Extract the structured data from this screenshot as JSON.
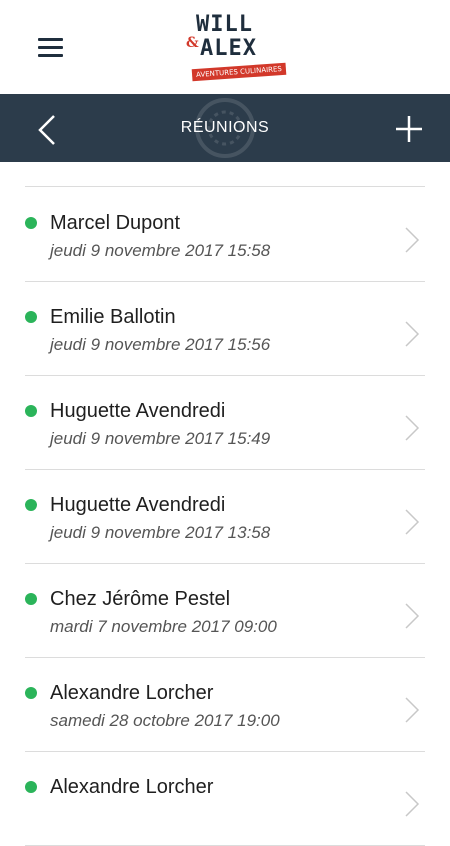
{
  "header": {
    "logo": {
      "line1": "WILL",
      "ampersand": "&",
      "line2": "ALEX",
      "tagline": "AVENTURES CULINAIRES"
    },
    "menu_icon": "hamburger-menu-icon"
  },
  "navbar": {
    "title": "RÉUNIONS",
    "back_icon": "chevron-left-icon",
    "add_icon": "plus-icon",
    "background_color": "#2c3c4b"
  },
  "meetings": [
    {
      "name": "Marcel Dupont",
      "date": "jeudi 9 novembre 2017 15:58",
      "status_color": "#2bb45a"
    },
    {
      "name": "Emilie Ballotin",
      "date": "jeudi 9 novembre 2017 15:56",
      "status_color": "#2bb45a"
    },
    {
      "name": "Huguette Avendredi",
      "date": "jeudi 9 novembre 2017 15:49",
      "status_color": "#2bb45a"
    },
    {
      "name": "Huguette Avendredi",
      "date": "jeudi 9 novembre 2017 13:58",
      "status_color": "#2bb45a"
    },
    {
      "name": "Chez Jérôme Pestel",
      "date": "mardi 7 novembre 2017 09:00",
      "status_color": "#2bb45a"
    },
    {
      "name": "Alexandre Lorcher",
      "date": "samedi 28 octobre 2017 19:00",
      "status_color": "#2bb45a"
    },
    {
      "name": "Alexandre Lorcher",
      "date": "",
      "status_color": "#2bb45a"
    }
  ]
}
